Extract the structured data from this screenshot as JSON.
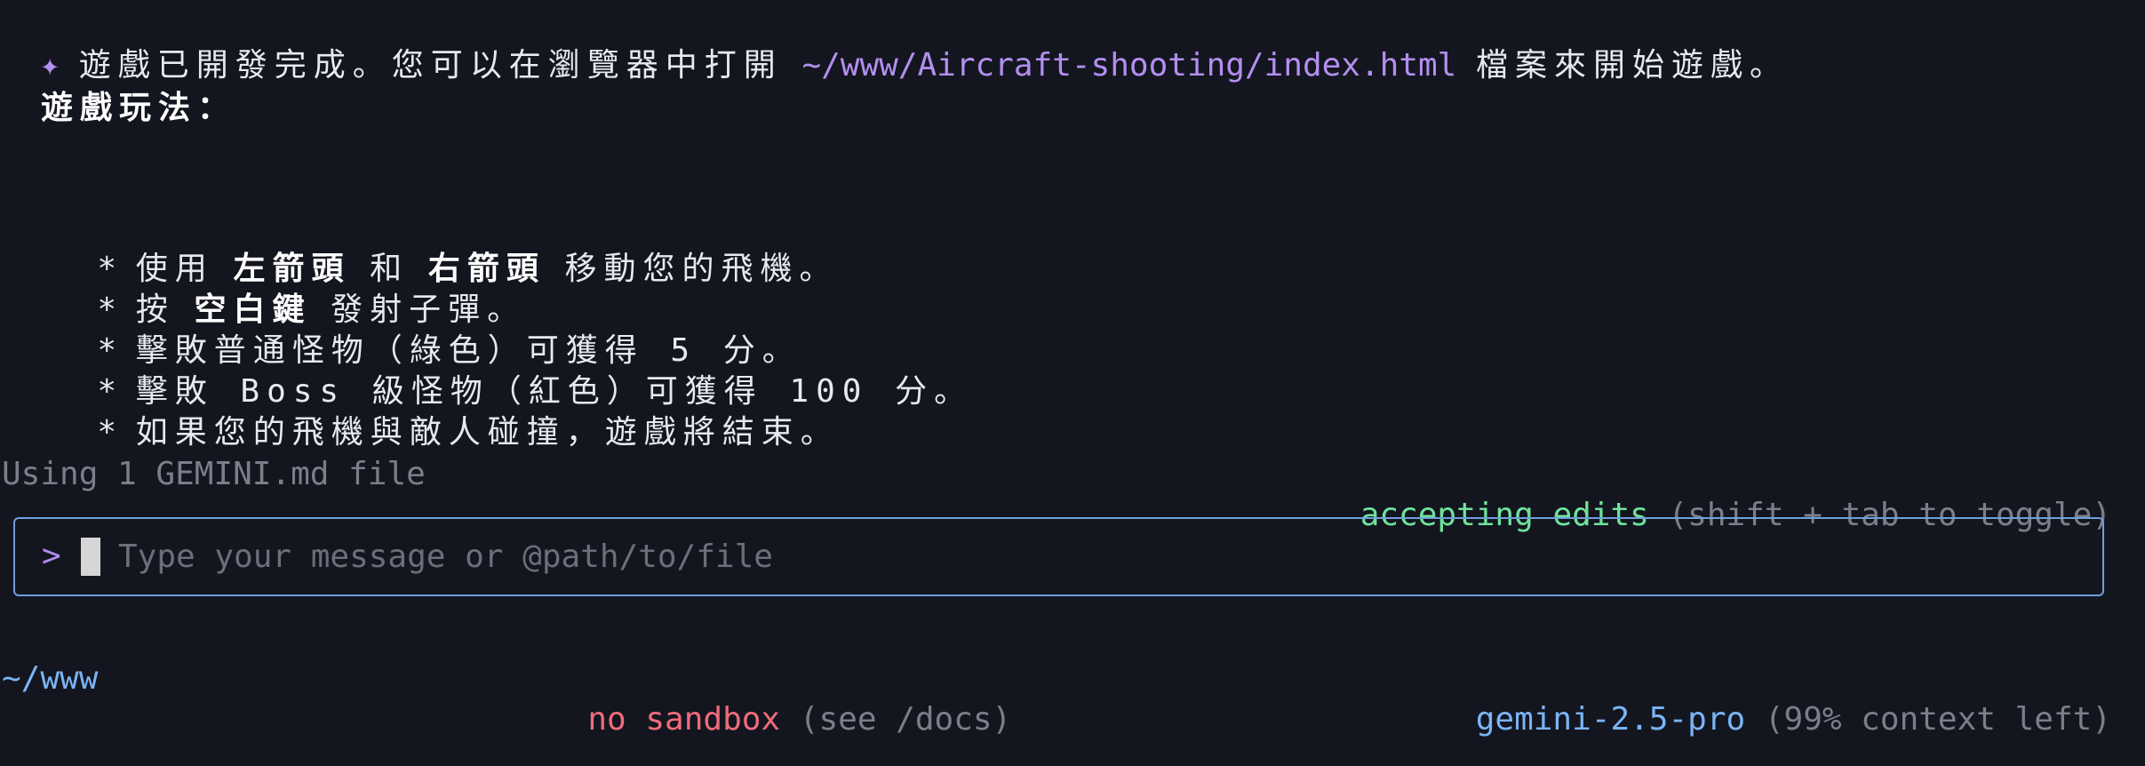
{
  "response": {
    "bullet_icon": "✦",
    "intro_text": "遊戲已開發完成。您可以在瀏覽器中打開",
    "file_path": "~/www/Aircraft-shooting/index.html",
    "intro_suffix": "檔案來開始遊戲。",
    "howto_heading": "遊戲玩法：",
    "rules": [
      {
        "marker": "*",
        "prefix": "使用",
        "key1": "左箭頭",
        "middle": "和",
        "key2": "右箭頭",
        "suffix": "移動您的飛機。"
      },
      {
        "marker": "*",
        "prefix": "按",
        "key1": "空白鍵",
        "suffix": "發射子彈。"
      },
      {
        "marker": "*",
        "text": "擊敗普通怪物（綠色）可獲得 5 分。"
      },
      {
        "marker": "*",
        "text": "擊敗 Boss 級怪物（紅色）可獲得 100 分。"
      },
      {
        "marker": "*",
        "text": "如果您的飛機與敵人碰撞，遊戲將結束。"
      }
    ]
  },
  "status": {
    "context_files": "Using 1 GEMINI.md file",
    "mode": "accepting edits",
    "mode_hint": "(shift + tab to toggle)"
  },
  "input": {
    "prompt": ">",
    "placeholder": "Type your message or @path/to/file",
    "value": ""
  },
  "footer": {
    "cwd": "~/www",
    "sandbox": "no sandbox",
    "sandbox_hint": "(see /docs)",
    "model": "gemini-2.5-pro",
    "context_left": "(99% context left)"
  },
  "colors": {
    "background": "#13161f",
    "accent_purple": "#b48ef0",
    "accent_green": "#6fe39a",
    "accent_blue": "#7ab4f5",
    "accent_red": "#f06b7c",
    "dim_text": "#7b7f8a"
  }
}
